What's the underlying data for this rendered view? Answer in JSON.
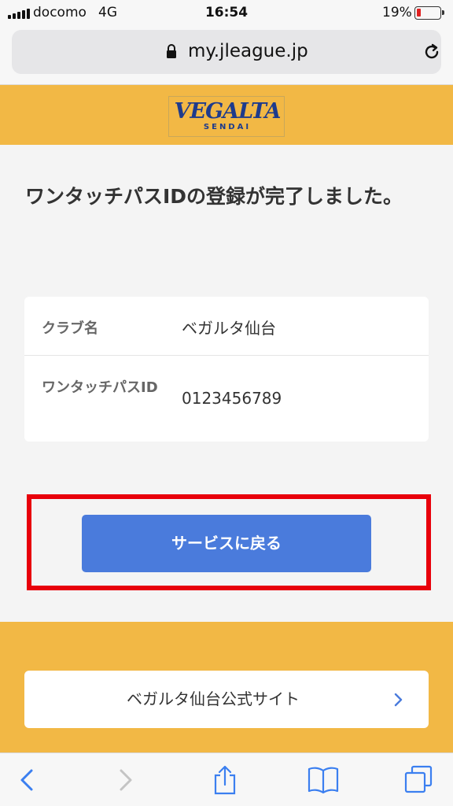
{
  "status_bar": {
    "carrier": "docomo",
    "network": "4G",
    "time": "16:54",
    "battery": "19%",
    "battery_level": 0.19,
    "battery_color": "#e02020"
  },
  "browser": {
    "url": "my.jleague.jp",
    "lock_icon": "lock-icon",
    "reload_icon": "reload-icon"
  },
  "header": {
    "logo_text": "VEGALTA",
    "logo_subtext": "SENDAI",
    "background_color": "#f2b845",
    "brand_color": "#1e3b8c"
  },
  "main": {
    "title": "ワンタッチパスIDの登録が完了しました。",
    "rows": [
      {
        "label": "クラブ名",
        "value": "ベガルタ仙台"
      },
      {
        "label": "ワンタッチパスID",
        "value": "0123456789"
      }
    ],
    "back_button": "サービスに戻る",
    "button_color": "#4a7bdc",
    "highlight_color": "#e8000b"
  },
  "footer": {
    "official_link": "ベガルタ仙台公式サイト"
  },
  "toolbar": {
    "icons": [
      "back-icon",
      "forward-icon",
      "share-icon",
      "bookmarks-icon",
      "tabs-icon"
    ]
  }
}
